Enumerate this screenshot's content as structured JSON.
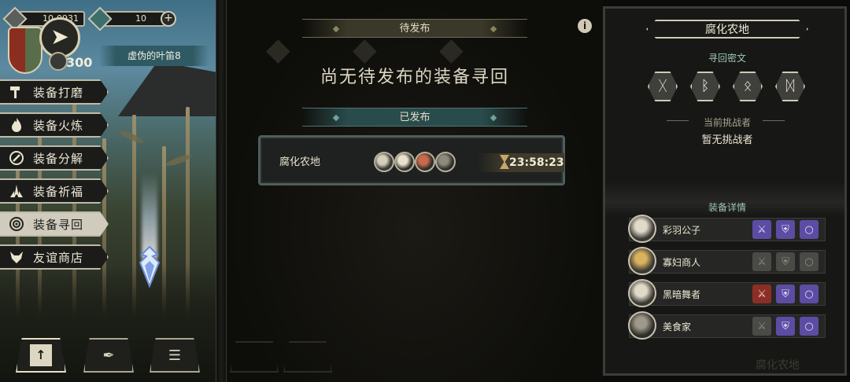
{
  "resources": {
    "gem_count": "10-0931",
    "crystal_count": "10"
  },
  "player": {
    "score": "300",
    "stage_name": "虚伪的叶笛8"
  },
  "menu": [
    {
      "label": "装备打磨",
      "icon": "hammer-icon"
    },
    {
      "label": "装备火炼",
      "icon": "flame-icon"
    },
    {
      "label": "装备分解",
      "icon": "split-icon"
    },
    {
      "label": "装备祈福",
      "icon": "blessing-icon"
    },
    {
      "label": "装备寻回",
      "icon": "target-icon",
      "active": true
    },
    {
      "label": "友谊商店",
      "icon": "fox-icon"
    }
  ],
  "pending": {
    "header": "待发布",
    "empty_message": "尚无待发布的装备寻回"
  },
  "published": {
    "header": "已发布",
    "card": {
      "name": "腐化农地",
      "timer": "23:58:23"
    }
  },
  "detail": {
    "title": "腐化农地",
    "cipher_label": "寻回密文",
    "runes": [
      "ᚷ",
      "ᛒ",
      "ᛟ",
      "ᛞ"
    ],
    "challenger_label": "当前挑战者",
    "challenger_value": "暂无挑战者",
    "equipment_label": "装备详情",
    "equipment": [
      {
        "name": "彩羽公子",
        "slots": [
          "purple",
          "purple",
          "purple"
        ]
      },
      {
        "name": "寡妇商人",
        "slots": [
          "gray",
          "gray",
          "gray"
        ]
      },
      {
        "name": "黑暗舞者",
        "slots": [
          "red",
          "purple",
          "purple"
        ]
      },
      {
        "name": "美食家",
        "slots": [
          "gray",
          "purple",
          "purple"
        ]
      }
    ]
  },
  "footer_faint": "腐化农地",
  "colors": {
    "accent_teal": "#294b4b",
    "rare_purple": "#5d4ca3",
    "epic_red": "#8b2f26"
  }
}
